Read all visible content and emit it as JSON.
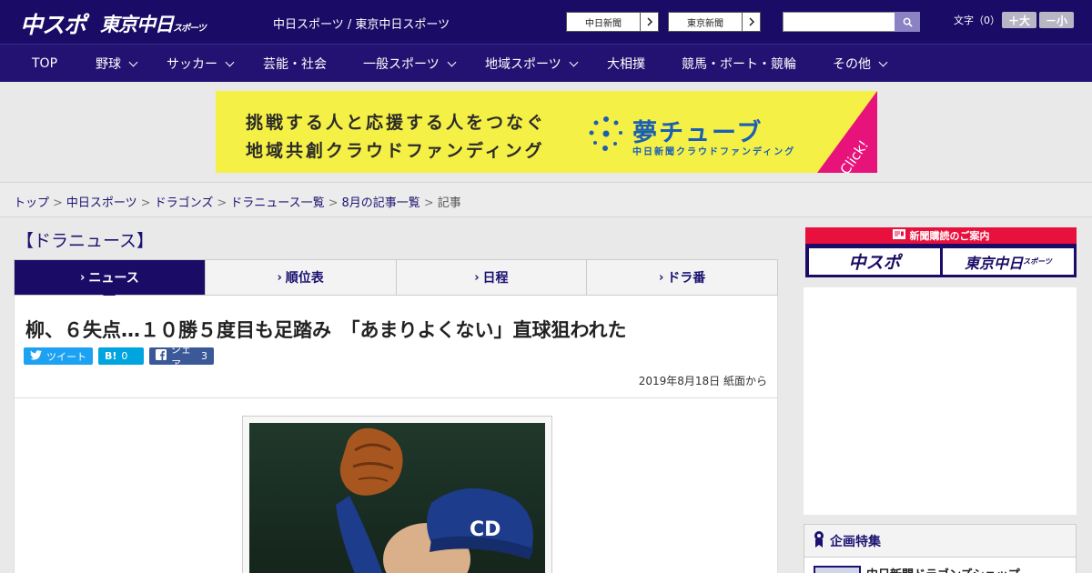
{
  "header": {
    "logo_main": "中スポ",
    "logo_tokyo": "東京中日",
    "logo_tokyo_suffix": "スポーツ",
    "site_name": "中日スポーツ / 東京中日スポーツ",
    "paper_links": [
      "中日新聞",
      "東京新聞"
    ],
    "font_label": "文字（0）",
    "font_larger": "＋大",
    "font_smaller": "－小"
  },
  "nav": {
    "items": [
      {
        "label": "TOP",
        "has_menu": false
      },
      {
        "label": "野球",
        "has_menu": true
      },
      {
        "label": "サッカー",
        "has_menu": true
      },
      {
        "label": "芸能・社会",
        "has_menu": false
      },
      {
        "label": "一般スポーツ",
        "has_menu": true
      },
      {
        "label": "地域スポーツ",
        "has_menu": true
      },
      {
        "label": "大相撲",
        "has_menu": false
      },
      {
        "label": "競馬・ボート・競輪",
        "has_menu": false
      },
      {
        "label": "その他",
        "has_menu": true
      }
    ]
  },
  "banner": {
    "line1": "挑戦する人と応援する人をつなぐ",
    "line2": "地域共創クラウドファンディング",
    "brand": "夢チューブ",
    "brand_sub": "中日新聞クラウドファンディング",
    "click": "Click!",
    "bg_color": "#f5f046",
    "accent_color": "#e8127b"
  },
  "breadcrumb": {
    "links": [
      "トップ",
      "中日スポーツ",
      "ドラゴンズ",
      "ドラニュース一覧",
      "8月の記事一覧"
    ],
    "current": "記事",
    "separator": ">"
  },
  "section": {
    "title": "【ドラニュース】"
  },
  "tabs": [
    {
      "label": "ニュース",
      "active": true
    },
    {
      "label": "順位表",
      "active": false
    },
    {
      "label": "日程",
      "active": false
    },
    {
      "label": "ドラ番",
      "active": false
    }
  ],
  "article": {
    "headline": "柳、６失点…１０勝５度目も足踏み　「あまりよくない」直球狙われた",
    "share": {
      "tweet": "ツイート",
      "hatena_icon": "B!",
      "hatena_count": "0",
      "facebook": "シェア",
      "facebook_count": "3"
    },
    "date": "2019年8月18日 紙面から"
  },
  "sidebar": {
    "subscribe_head": "新聞購読のご案内",
    "subscribe_logos": [
      "中スポ",
      "東京中日"
    ],
    "subscribe_logo_suffix": "スポーツ",
    "feature_title": "企画特集",
    "feature_item": "中日新聞ドラゴンズショップ"
  },
  "colors": {
    "brand_navy": "#1a0c66",
    "nav_bg": "#231272",
    "tweet": "#1da1f2",
    "hatena": "#00a4de",
    "facebook": "#3b5998",
    "subscribe_red": "#e8103c"
  },
  "icons": [
    "chevron-right-icon",
    "search-icon",
    "chevron-down-icon",
    "twitter-icon",
    "facebook-icon",
    "newspaper-icon",
    "ribbon-icon"
  ]
}
